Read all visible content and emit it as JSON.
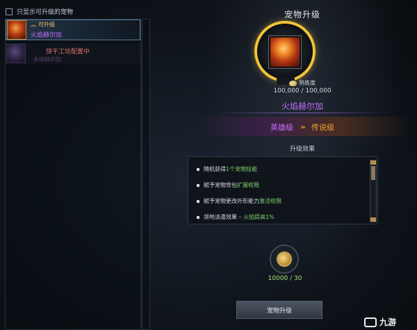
{
  "filter": {
    "label": "只显示可升级的宠物",
    "checked": false
  },
  "pets": [
    {
      "tag": "可升级",
      "name": "火焰赫尔加"
    },
    {
      "status": "饼干工坊配置中",
      "name": "永暗赫尔加"
    }
  ],
  "panel": {
    "title": "宠物升级",
    "proficiency_label": "熟练度",
    "proficiency_value": "100,000 / 100,000",
    "pet_name": "火焰赫尔加",
    "tier_from": "英雄级",
    "tier_arrows": "›››",
    "tier_to": "传说级",
    "effects_title": "升级效果",
    "effects": [
      {
        "pre": "随机获得",
        "hl": "1个宠物技能",
        "post": ""
      },
      {
        "pre": "赋予宠物背包",
        "hl": "扩展权限",
        "post": ""
      },
      {
        "pre": "赋予宠物更改外形能力",
        "hl": "激活权限",
        "post": ""
      },
      {
        "pre": "领地派遣效果 – ",
        "hl": "火焰提高1%",
        "post": ""
      }
    ],
    "material_count": "10000 / 30",
    "upgrade_button": "宠物升级"
  },
  "watermark": "九游",
  "colors": {
    "accent_gold": "#f0c43a",
    "legendary": "#f0a030",
    "hero": "#c46cff",
    "highlight": "#7fd46a"
  }
}
